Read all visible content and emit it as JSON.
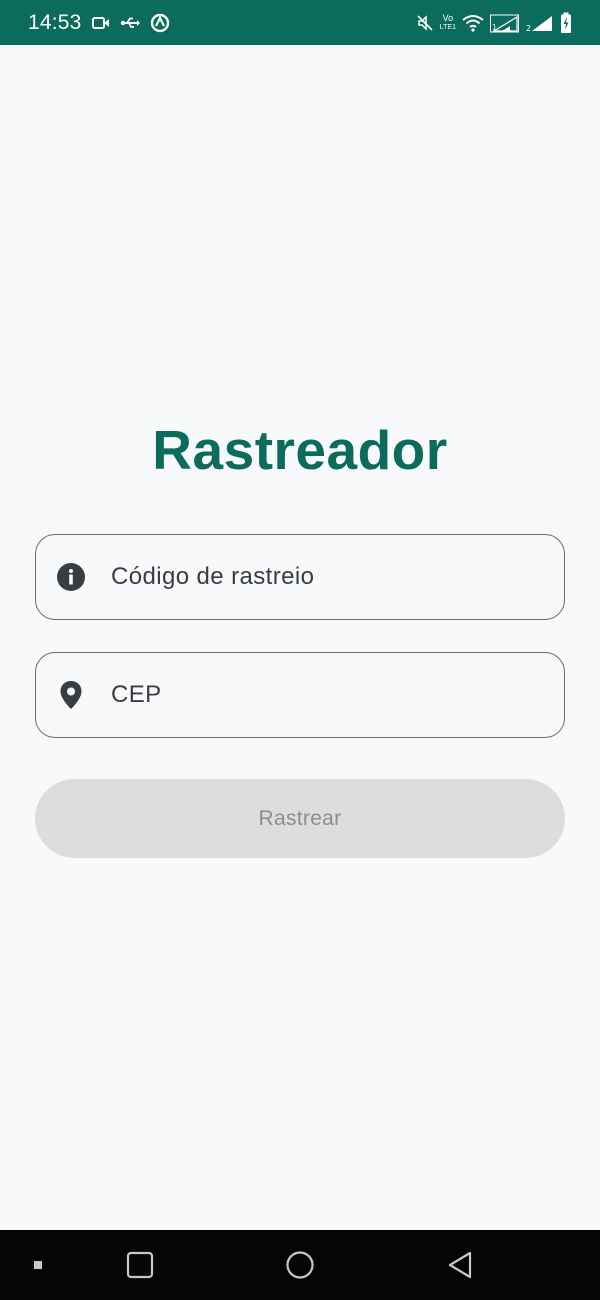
{
  "status_bar": {
    "time": "14:53",
    "left_icons": [
      "video-camera-icon",
      "usb-icon",
      "sync-icon"
    ],
    "right_icons": [
      "mute-icon",
      "volte-icon",
      "wifi-icon",
      "signal-sim1-icon",
      "signal-sim2-icon",
      "battery-charging-icon"
    ],
    "volte_top": "Vo",
    "volte_bottom": "LTE1",
    "background": "#0b6b5c"
  },
  "app": {
    "title": "Rastreador",
    "accent_color": "#0b6b5c"
  },
  "form": {
    "tracking_code": {
      "placeholder": "Código de rastreio",
      "value": "",
      "icon": "info-icon"
    },
    "zip_code": {
      "placeholder": "CEP",
      "value": "",
      "icon": "location-pin-icon"
    },
    "track_button": {
      "label": "Rastrear",
      "enabled": false
    }
  },
  "navigation_bar": {
    "buttons": [
      "menu-dot-icon",
      "recents-square-icon",
      "home-circle-icon",
      "back-triangle-icon"
    ]
  }
}
